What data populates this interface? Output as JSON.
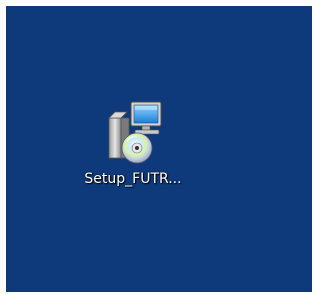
{
  "desktop": {
    "background_color": "#0e3a7c",
    "icons": [
      {
        "label": "Setup_FUTR...",
        "icon": "installer-icon"
      }
    ]
  }
}
